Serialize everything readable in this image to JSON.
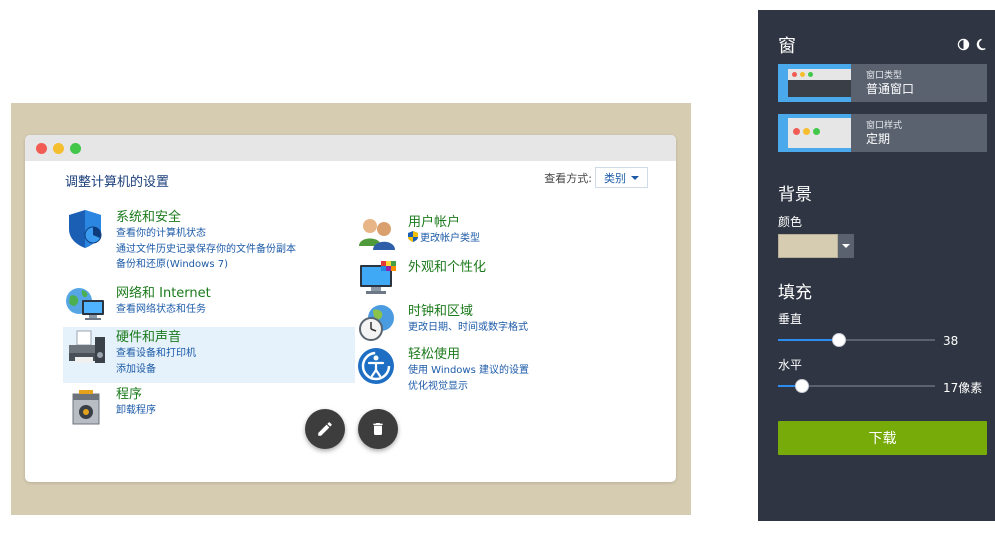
{
  "colors": {
    "canvas_background": "#d6ccb2",
    "panel_background": "#2f3542",
    "accent_blue": "#2d8cf0",
    "download_green": "#77ab0a",
    "link_blue": "#1d5ba8",
    "category_green": "#1b7a1b"
  },
  "preview": {
    "window": {
      "title_dots": [
        "red",
        "yellow",
        "green"
      ]
    },
    "control_panel": {
      "title": "调整计算机的设置",
      "view_by_label": "查看方式:",
      "view_by_value": "类别",
      "left_categories": [
        {
          "icon": "shield-icon",
          "title": "系统和安全",
          "links": [
            "查看你的计算机状态",
            "通过文件历史记录保存你的文件备份副本",
            "备份和还原(Windows 7)"
          ]
        },
        {
          "icon": "network-globe-icon",
          "title": "网络和 Internet",
          "links": [
            "查看网络状态和任务"
          ]
        },
        {
          "icon": "printer-speaker-icon",
          "title": "硬件和声音",
          "links": [
            "查看设备和打印机",
            "添加设备"
          ],
          "highlighted": true
        },
        {
          "icon": "programs-icon",
          "title": "程序",
          "links": [
            "卸载程序"
          ]
        }
      ],
      "right_categories": [
        {
          "icon": "users-icon",
          "title": "用户帐户",
          "links": [
            "更改帐户类型"
          ]
        },
        {
          "icon": "monitor-palette-icon",
          "title": "外观和个性化",
          "links": []
        },
        {
          "icon": "clock-globe-icon",
          "title": "时钟和区域",
          "links": [
            "更改日期、时间或数字格式"
          ]
        },
        {
          "icon": "ease-of-access-icon",
          "title": "轻松使用",
          "links": [
            "使用 Windows 建议的设置",
            "优化视觉显示"
          ]
        }
      ]
    },
    "actions": [
      {
        "icon": "pencil-icon"
      },
      {
        "icon": "trash-icon"
      }
    ]
  },
  "panel": {
    "heading": "窗",
    "theme_icons": [
      "light-theme-icon",
      "moon-icon"
    ],
    "window_type": {
      "label": "窗口类型",
      "value": "普通窗口"
    },
    "window_style": {
      "label": "窗口样式",
      "value": "定期"
    },
    "background": {
      "title": "背景",
      "color_label": "颜色",
      "color_value": "#d6ccb2"
    },
    "padding": {
      "title": "填充",
      "vertical_label": "垂直",
      "vertical_value": "38",
      "vertical_fraction": 0.39,
      "horizontal_label": "水平",
      "horizontal_value": "17像素",
      "horizontal_fraction": 0.15
    },
    "download_label": "下载"
  }
}
